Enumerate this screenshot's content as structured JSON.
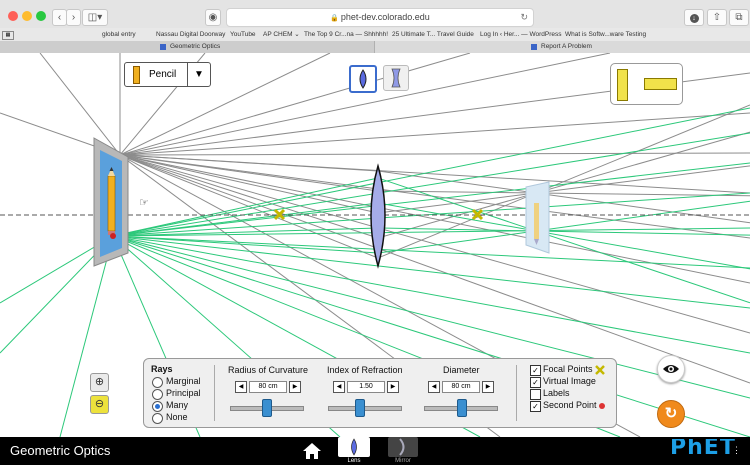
{
  "browser": {
    "url": "phet-dev.colorado.edu",
    "bookmarks": [
      "global entry",
      "Nassau Digital Doorway",
      "YouTube",
      "AP CHEM ⌄",
      "The Top 9 Cr...na — Shhhhh!",
      "25 Ultimate T... Travel Guide",
      "Log In ‹ Her... — WordPress",
      "What is Softw...ware Testing"
    ],
    "tabs": [
      {
        "label": "Geometric Optics",
        "active": true
      },
      {
        "label": "Report A Problem",
        "active": false
      }
    ]
  },
  "sim": {
    "object_selector": {
      "value": "Pencil"
    },
    "controls": {
      "rays": {
        "title": "Rays",
        "options": [
          "Marginal",
          "Principal",
          "Many",
          "None"
        ],
        "selected": "Many"
      },
      "radius": {
        "title": "Radius of Curvature",
        "value": "80 cm",
        "level": 0.5
      },
      "index": {
        "title": "Index of Refraction",
        "value": "1.50",
        "level": 0.5
      },
      "diameter": {
        "title": "Diameter",
        "value": "80 cm",
        "level": 0.5
      },
      "checkboxes": [
        {
          "label": "Focal Points",
          "checked": true
        },
        {
          "label": "Virtual Image",
          "checked": true
        },
        {
          "label": "Labels",
          "checked": false
        },
        {
          "label": "Second Point",
          "checked": true
        }
      ]
    },
    "colors": {
      "ray_gray": "#8c8c8c",
      "ray_green": "#2cc87a",
      "lens": "#9ea6e8",
      "focal": "#e8e000",
      "phet_blue": "#1d9fe6"
    }
  },
  "nav": {
    "title": "Geometric Optics",
    "screens": [
      "Lens",
      "Mirror"
    ],
    "selected": "Lens",
    "logo": "PhET"
  }
}
